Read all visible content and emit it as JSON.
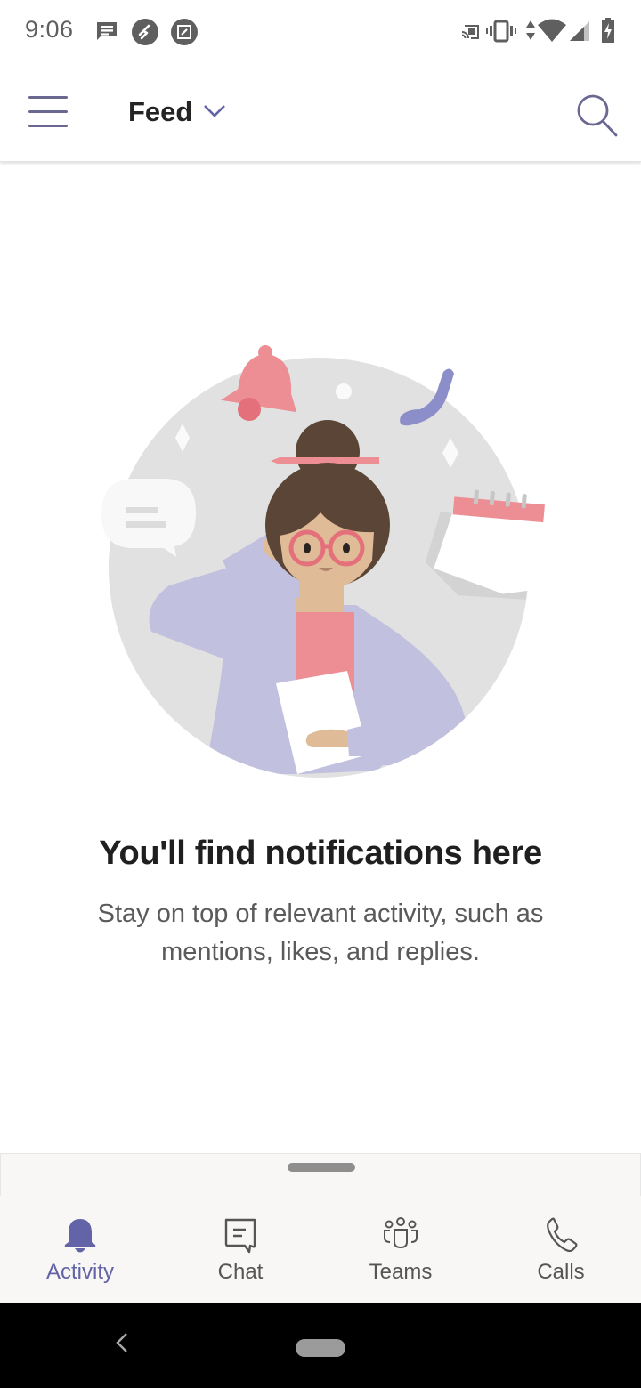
{
  "status_bar": {
    "time": "9:06",
    "left_icons": [
      "message-notification-icon",
      "remote-desktop-icon",
      "screenshot-edit-icon"
    ],
    "right_icons": [
      "cast-icon",
      "vibrate-icon",
      "data-arrows-icon",
      "wifi-icon",
      "cell-signal-icon",
      "battery-charging-icon"
    ]
  },
  "header": {
    "menu_icon": "hamburger-menu-icon",
    "title": "Feed",
    "title_dropdown_icon": "chevron-down-icon",
    "search_icon": "search-icon"
  },
  "empty_state": {
    "illustration": "woman-with-notifications-illustration",
    "title": "You'll find notifications here",
    "description": "Stay on top of relevant activity, such as mentions, likes, and replies."
  },
  "bottom_nav": {
    "items": [
      {
        "label": "Activity",
        "icon": "bell-icon",
        "active": true
      },
      {
        "label": "Chat",
        "icon": "chat-icon",
        "active": false
      },
      {
        "label": "Teams",
        "icon": "teams-icon",
        "active": false
      },
      {
        "label": "Calls",
        "icon": "phone-icon",
        "active": false
      }
    ]
  },
  "colors": {
    "accent": "#6264a7",
    "header_icon": "#6a6891",
    "title_text": "#242424",
    "body_text": "#5a5a5a",
    "nav_background": "#f8f7f6"
  }
}
